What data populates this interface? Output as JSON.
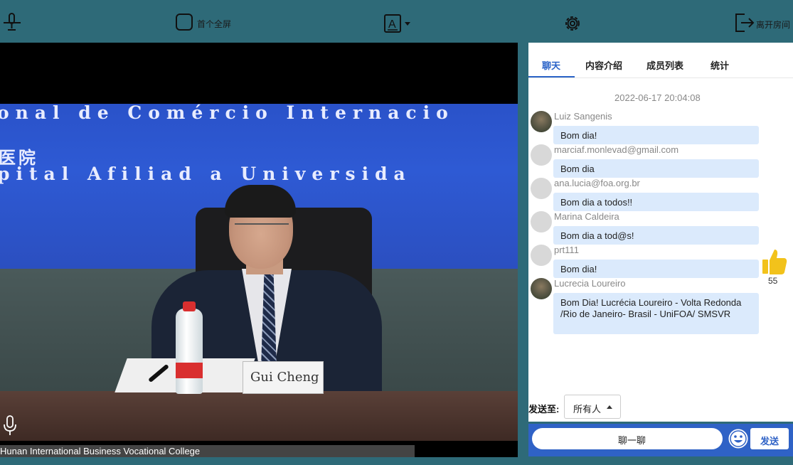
{
  "toolbar": {
    "fullscreen_label": "首个全屏",
    "leave_label": "离开房间"
  },
  "video": {
    "banner_line1": "onal de Comércio Internacio",
    "banner_line2_cn": "医院",
    "banner_line3": "pital Afiliad a Universida",
    "nameplate": "Gui Cheng",
    "caption": "Hunan International Business Vocational College"
  },
  "tabs": [
    {
      "label": "聊天"
    },
    {
      "label": "内容介绍"
    },
    {
      "label": "成员列表"
    },
    {
      "label": "统计"
    }
  ],
  "chat": {
    "timestamp": "2022-06-17 20:04:08",
    "messages": [
      {
        "name": "Luiz Sangenis",
        "text": "Bom dia!"
      },
      {
        "name": "marciaf.monlevad@gmail.com",
        "text": "Bom dia"
      },
      {
        "name": "ana.lucia@foa.org.br",
        "text": "Bom dia a todos!!"
      },
      {
        "name": "Marina Caldeira",
        "text": "Bom dia a tod@s!"
      },
      {
        "name": "prt111",
        "text": "Bom dia!"
      },
      {
        "name": "Lucrecia Loureiro",
        "text": "Bom Dia! Lucrécia Loureiro - Volta Redonda /Rio de Janeiro- Brasil - UniFOA/ SMSVR"
      }
    ]
  },
  "likes": {
    "count": "55"
  },
  "send": {
    "to_label": "发送至:",
    "recipient": "所有人",
    "input_placeholder": "聊一聊",
    "send_label": "发送"
  },
  "colors": {
    "accent": "#2f62c6",
    "bubble": "#dbeafc",
    "like": "#f2c21b",
    "background": "#2e6a78"
  }
}
